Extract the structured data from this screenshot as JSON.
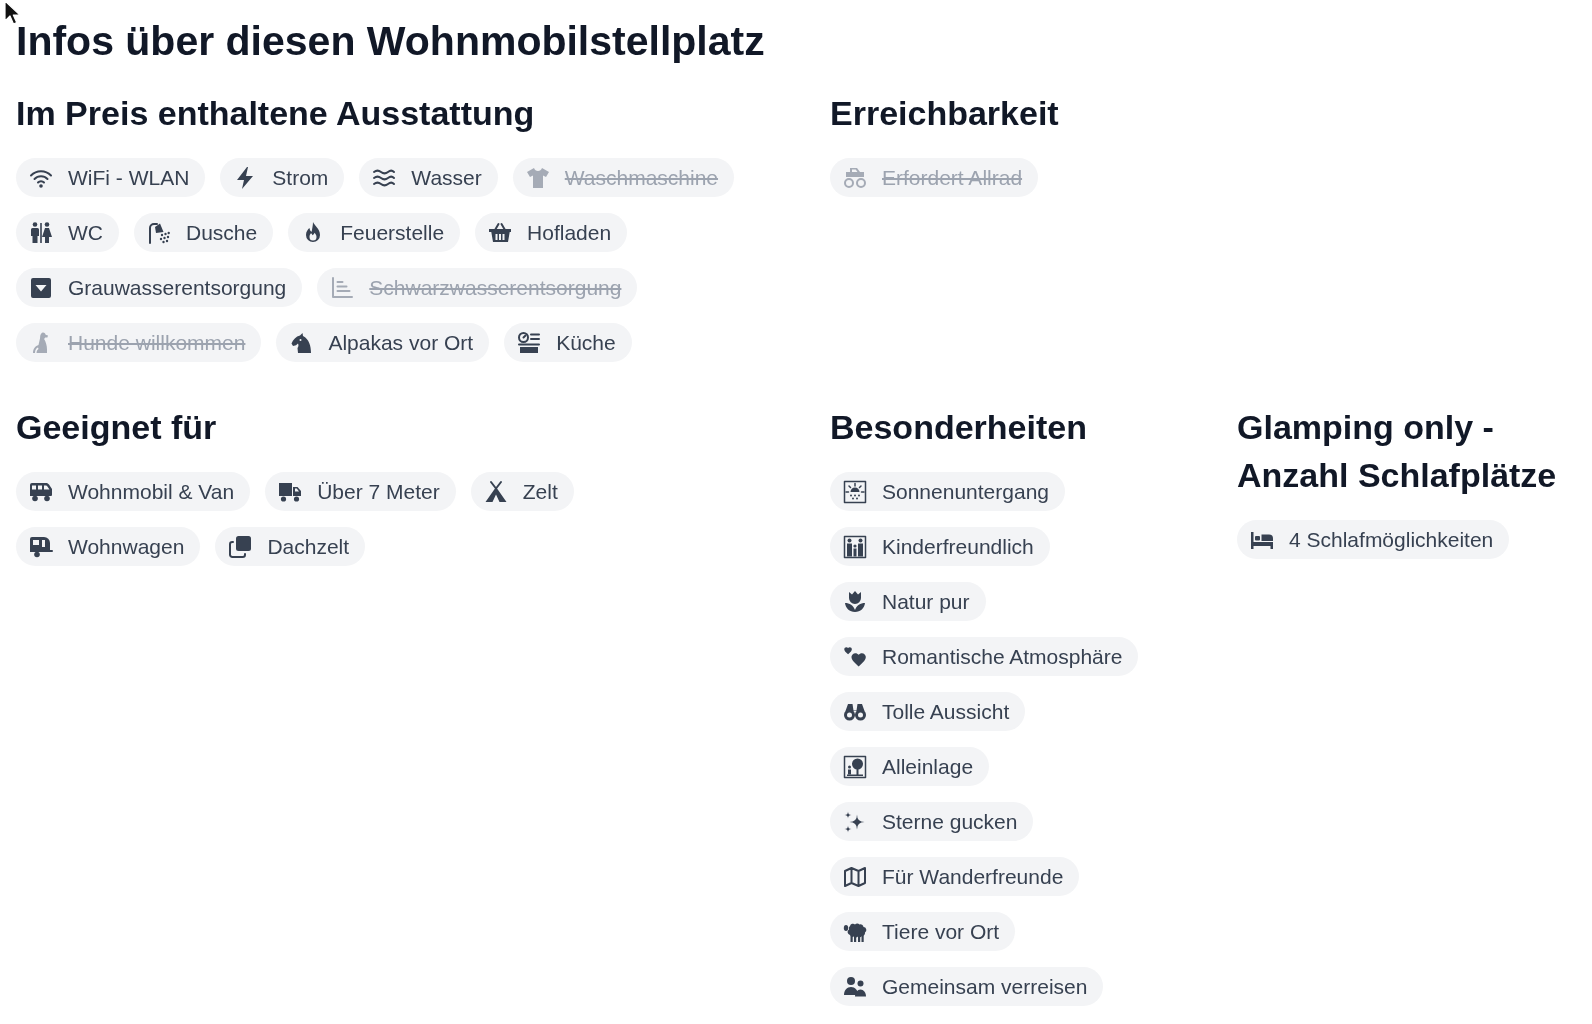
{
  "title": "Infos über diesen Wohnmobilstellplatz",
  "sections": [
    {
      "heading": "Im Preis enthaltene Ausstattung",
      "items": [
        {
          "label": "WiFi - WLAN",
          "included": true
        },
        {
          "label": "Strom",
          "included": true
        },
        {
          "label": "Wasser",
          "included": true
        },
        {
          "label": "Waschmaschine",
          "included": false
        },
        {
          "label": "WC",
          "included": true
        },
        {
          "label": "Dusche",
          "included": true
        },
        {
          "label": "Feuerstelle",
          "included": true
        },
        {
          "label": "Hofladen",
          "included": true
        },
        {
          "label": "Grauwasserentsorgung",
          "included": true
        },
        {
          "label": "Schwarzwasserentsorgung",
          "included": false
        },
        {
          "label": "Hunde willkommen",
          "included": false
        },
        {
          "label": "Alpakas vor Ort",
          "included": true
        },
        {
          "label": "Küche",
          "included": true
        }
      ]
    },
    {
      "heading": "Erreichbarkeit",
      "items": [
        {
          "label": "Erfordert Allrad",
          "included": false
        }
      ]
    },
    {
      "heading": "Geeignet für",
      "items": [
        {
          "label": "Wohnmobil & Van",
          "included": true
        },
        {
          "label": "Über 7 Meter",
          "included": true
        },
        {
          "label": "Zelt",
          "included": true
        },
        {
          "label": "Wohnwagen",
          "included": true
        },
        {
          "label": "Dachzelt",
          "included": true
        }
      ]
    },
    {
      "heading": "Besonderheiten",
      "items": [
        {
          "label": "Sonnenuntergang",
          "included": true
        },
        {
          "label": "Kinderfreundlich",
          "included": true
        },
        {
          "label": "Natur pur",
          "included": true
        },
        {
          "label": "Romantische Atmosphäre",
          "included": true
        },
        {
          "label": "Tolle Aussicht",
          "included": true
        },
        {
          "label": "Alleinlage",
          "included": true
        },
        {
          "label": "Sterne gucken",
          "included": true
        },
        {
          "label": "Für Wanderfreunde",
          "included": true
        },
        {
          "label": "Tiere vor Ort",
          "included": true
        },
        {
          "label": "Gemeinsam verreisen",
          "included": true
        }
      ]
    },
    {
      "heading": "Glamping only - Anzahl Schlafplätze",
      "items": [
        {
          "label": "4 Schlafmöglichkeiten",
          "included": true
        }
      ]
    }
  ]
}
